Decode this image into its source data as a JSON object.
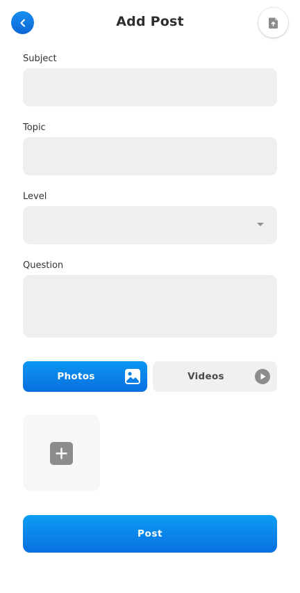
{
  "header": {
    "title": "Add Post",
    "back_icon": "chevron-left-icon",
    "action_icon": "file-upload-icon"
  },
  "form": {
    "subject": {
      "label": "Subject",
      "value": ""
    },
    "topic": {
      "label": "Topic",
      "value": ""
    },
    "level": {
      "label": "Level",
      "value": ""
    },
    "question": {
      "label": "Question",
      "value": ""
    }
  },
  "media_tabs": {
    "photos": {
      "label": "Photos",
      "icon": "image-icon",
      "active": true
    },
    "videos": {
      "label": "Videos",
      "icon": "play-circle-icon",
      "active": false
    }
  },
  "media": {
    "add_icon": "plus-icon"
  },
  "actions": {
    "post_label": "Post"
  },
  "colors": {
    "accent": "#0a84ea",
    "field_bg": "#efefef",
    "inactive_tab_bg": "#f0f0f0"
  }
}
